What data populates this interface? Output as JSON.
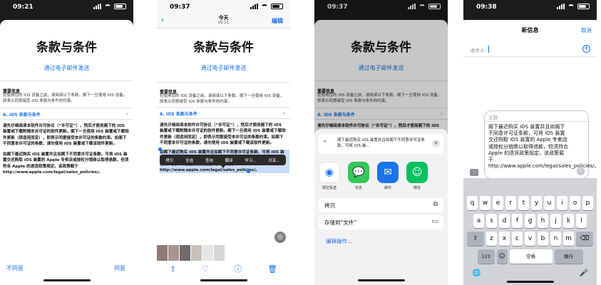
{
  "screens": [
    {
      "id": "terms-sheet",
      "time": "09:21",
      "title": "条款与条件",
      "email_link": "通过电子邮件发送",
      "important_heading": "重要信息",
      "important_text": "在使用您的 iOS 设备之前，请阅读以下条款。阁下一旦使用 iOS 设备，即表示同意接受 iOS 条款与条件的约束。",
      "section_link": "A. iOS 条款与条件",
      "para1": "请先仔细阅读本软件许可协议（“许可证”），然后才使用阁下的 iOS 装置或下载附随本许可证的软件更新。阁下一旦使用 iOS 装置或下载软件更新（视适用而定），即表示同意接受本许可证的条款约束。如阁下不同意本许可证的条款，请勿使用 iOS 装置或下载该软件更新。",
      "para2": "如阁下最近购买 iOS 装置并且如阁下不同意许可证条款，可将 iOS 装置交还购取 iOS 装置的 Apple 专卖店或授权分销商以取得退款，但须符合 Apple 的退货政策规定，该政策载于 http://www.apple.com/legal/sales_policies/。",
      "disagree": "不同意",
      "agree": "同意"
    },
    {
      "id": "notes-selection",
      "time": "09:37",
      "nav_date": "今天",
      "nav_time": "09:21",
      "edit": "编辑",
      "title": "条款与条件",
      "email_link": "通过电子邮件发送",
      "important_heading": "重要信息",
      "important_text": "在使用您的 iOS 设备之前，请阅读以下条款。阁下一旦使用 iOS 设备，即表示同意接受 iOS 条款与条件的约束。",
      "section_link": "A. iOS 条款与条件",
      "para1": "请先仔细阅读本软件许可协议（“许可证”），然后才使用阁下的 iOS 装置或下载附随本许可证的软件更新。阁下一旦使用 iOS 装置或下载软件更新（视适用而定），即表示同意接受本许可证的条款约束。如阁下不同意本许可证的条款，请勿使用 iOS 装置或下载该软件更新。",
      "para2_selected": "如阁下最近购买 iOS 装置并且如阁下不同意许可证条款，可将 iOS 装置交还购取 iOS 装置的 Apple 专卖店或授权分销商以取得退款，但须符合 Apple 的退货政策规定，该政策载于 http://www.apple.com/legal/sales_policies/。",
      "menu": [
        "拷贝",
        "全选",
        "查询",
        "翻译",
        "学习...",
        "共享..."
      ]
    },
    {
      "id": "share-sheet",
      "time": "09:37",
      "title": "条款与条件",
      "email_link": "通过电子邮件发送",
      "important_heading": "重要信息",
      "important_text": "在使用您的 iOS 设备之前，请阅读以下条款。阁下一旦使用 iOS 设备，即表示同意接受 iOS 条款与条件的约束。",
      "section_link": "A. iOS 条款与条件",
      "para1": "请先仔细阅读本软件许可协议（“许可证”），然后才使用阁下的 iOS 装置或下载附随本许可证的软件更新。",
      "preview_text": "阁下最近购买 iOS 装置并且如阁下不同意许可证条款，可将 iOS 装...",
      "apps": [
        {
          "label": "隔空投送",
          "icon": "airdrop-icon",
          "color": "#ffffff"
        },
        {
          "label": "信息",
          "icon": "messages-icon",
          "color": "#34c759"
        },
        {
          "label": "邮件",
          "icon": "mail-icon",
          "color": "#1a73e8"
        },
        {
          "label": "微信",
          "icon": "wechat-icon",
          "color": "#07c160"
        }
      ],
      "actions": [
        {
          "label": "拷贝",
          "icon": "copy-icon"
        },
        {
          "label": "存储到“文件”",
          "icon": "folder-icon"
        }
      ],
      "edit_actions": "编辑操作..."
    },
    {
      "id": "new-message",
      "time": "09:38",
      "title": "新信息",
      "cancel": "取消",
      "to_label": "收件人:",
      "subject_placeholder": "主题",
      "body": "阁下最近购买 iOS 装置并且如阁下不同意许可证条款，可将 iOS 装置交还购取 iOS 装置的 Apple 专卖店或授权分销商以取得退款，但须符合 Apple 的退货政策规定，该政策载于 http://www.apple.com/legal/sales_policies/。",
      "keyboard": {
        "row1": [
          "q",
          "w",
          "e",
          "r",
          "t",
          "y",
          "u",
          "i",
          "o",
          "p"
        ],
        "row2": [
          "a",
          "s",
          "d",
          "f",
          "g",
          "h",
          "j",
          "k",
          "l"
        ],
        "row3": [
          "z",
          "x",
          "c",
          "v",
          "b",
          "n",
          "m"
        ],
        "num": "123",
        "space": "空格",
        "return": "换行"
      }
    }
  ]
}
